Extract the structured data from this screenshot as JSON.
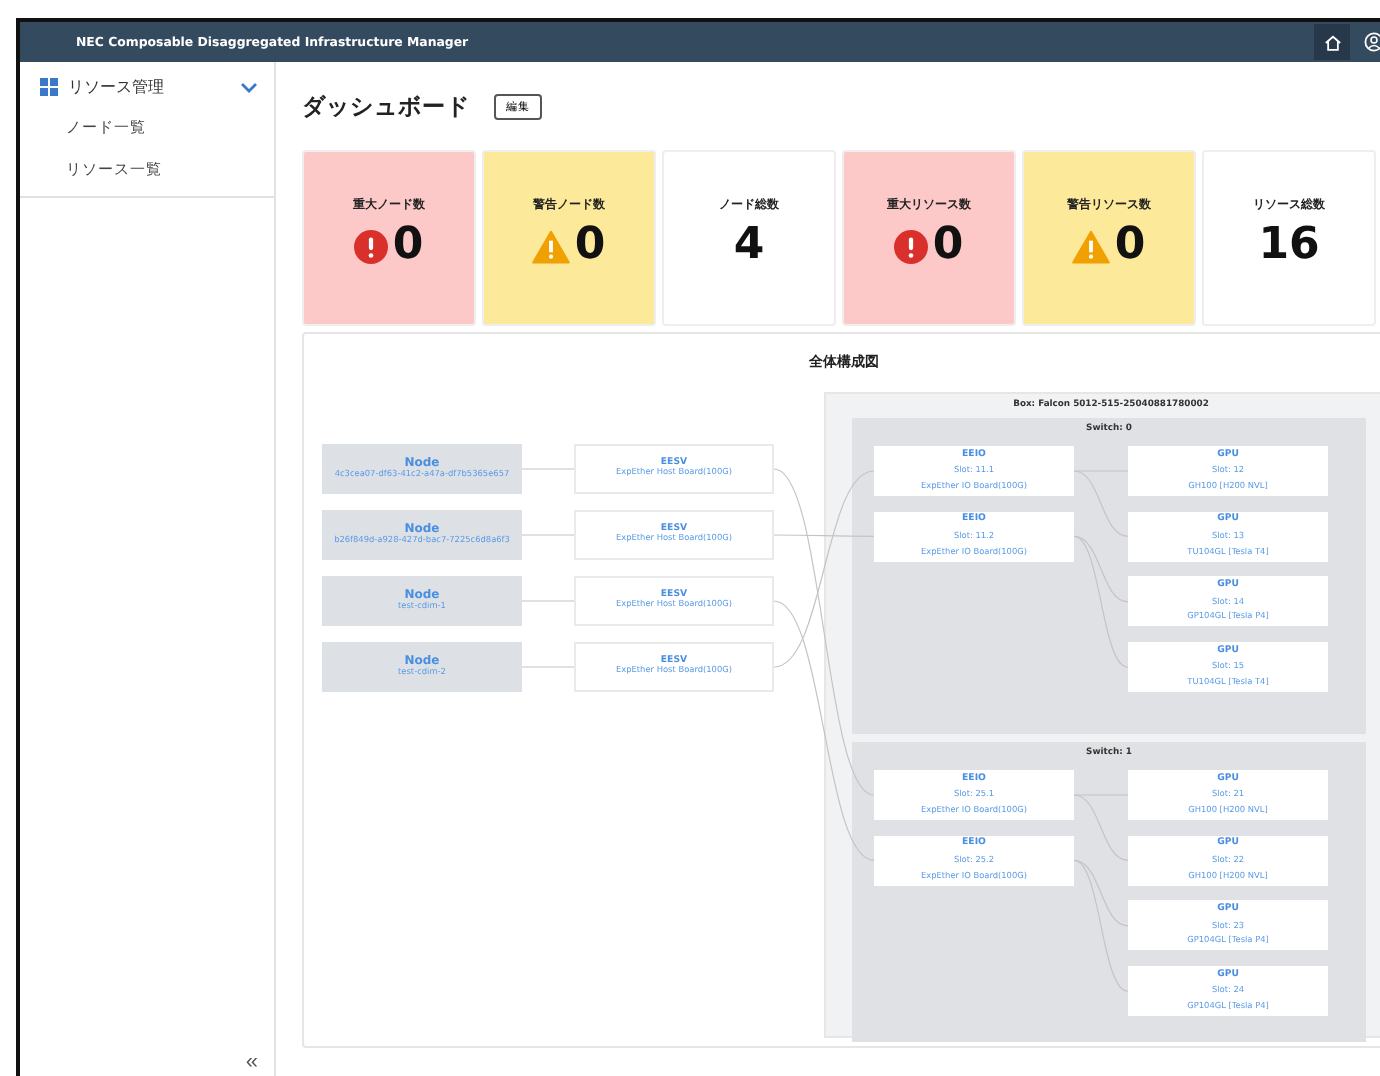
{
  "header": {
    "title": "NEC Composable Disaggregated Infrastructure Manager"
  },
  "sidebar": {
    "section": {
      "label": "リソース管理",
      "expanded": true
    },
    "items": [
      {
        "label": "ノード一覧"
      },
      {
        "label": "リソース一覧"
      }
    ],
    "collapse": "«"
  },
  "page": {
    "title": "ダッシュボード",
    "edit_button": "編集"
  },
  "cards": [
    {
      "label": "重大ノード数",
      "value": "0",
      "kind": "critical"
    },
    {
      "label": "警告ノード数",
      "value": "0",
      "kind": "warning"
    },
    {
      "label": "ノード総数",
      "value": "4",
      "kind": "total"
    },
    {
      "label": "重大リソース数",
      "value": "0",
      "kind": "critical"
    },
    {
      "label": "警告リソース数",
      "value": "0",
      "kind": "warning"
    },
    {
      "label": "リソース総数",
      "value": "16",
      "kind": "total"
    }
  ],
  "diagram": {
    "title": "全体構成図",
    "nodes": [
      {
        "label": "Node",
        "id": "4c3cea07-df63-41c2-a47a-df7b5365e657"
      },
      {
        "label": "Node",
        "id": "b26f849d-a928-427d-bac7-7225c6d8a6f3"
      },
      {
        "label": "Node",
        "id": "test-cdim-1"
      },
      {
        "label": "Node",
        "id": "test-cdim-2"
      }
    ],
    "eesv": [
      {
        "label": "EESV",
        "board": "ExpEther Host Board(100G)"
      },
      {
        "label": "EESV",
        "board": "ExpEther Host Board(100G)"
      },
      {
        "label": "EESV",
        "board": "ExpEther Host Board(100G)"
      },
      {
        "label": "EESV",
        "board": "ExpEther Host Board(100G)"
      }
    ],
    "box": {
      "title": "Box: Falcon 5012-515-25040881780002",
      "switches": [
        {
          "title": "Switch: 0",
          "eeio": [
            {
              "label": "EEIO",
              "slot": "Slot: 11.1",
              "board": "ExpEther IO Board(100G)"
            },
            {
              "label": "EEIO",
              "slot": "Slot: 11.2",
              "board": "ExpEther IO Board(100G)"
            }
          ],
          "gpus": [
            {
              "label": "GPU",
              "slot": "Slot: 12",
              "model": "GH100 [H200 NVL]"
            },
            {
              "label": "GPU",
              "slot": "Slot: 13",
              "model": "TU104GL [Tesla T4]"
            },
            {
              "label": "GPU",
              "slot": "Slot: 14",
              "model": "GP104GL [Tesla P4]"
            },
            {
              "label": "GPU",
              "slot": "Slot: 15",
              "model": "TU104GL [Tesla T4]"
            }
          ]
        },
        {
          "title": "Switch: 1",
          "eeio": [
            {
              "label": "EEIO",
              "slot": "Slot: 25.1",
              "board": "ExpEther IO Board(100G)"
            },
            {
              "label": "EEIO",
              "slot": "Slot: 25.2",
              "board": "ExpEther IO Board(100G)"
            }
          ],
          "gpus": [
            {
              "label": "GPU",
              "slot": "Slot: 21",
              "model": "GH100 [H200 NVL]"
            },
            {
              "label": "GPU",
              "slot": "Slot: 22",
              "model": "GH100 [H200 NVL]"
            },
            {
              "label": "GPU",
              "slot": "Slot: 23",
              "model": "GP104GL [Tesla P4]"
            },
            {
              "label": "GPU",
              "slot": "Slot: 24",
              "model": "GP104GL [Tesla P4]"
            }
          ]
        }
      ]
    }
  }
}
